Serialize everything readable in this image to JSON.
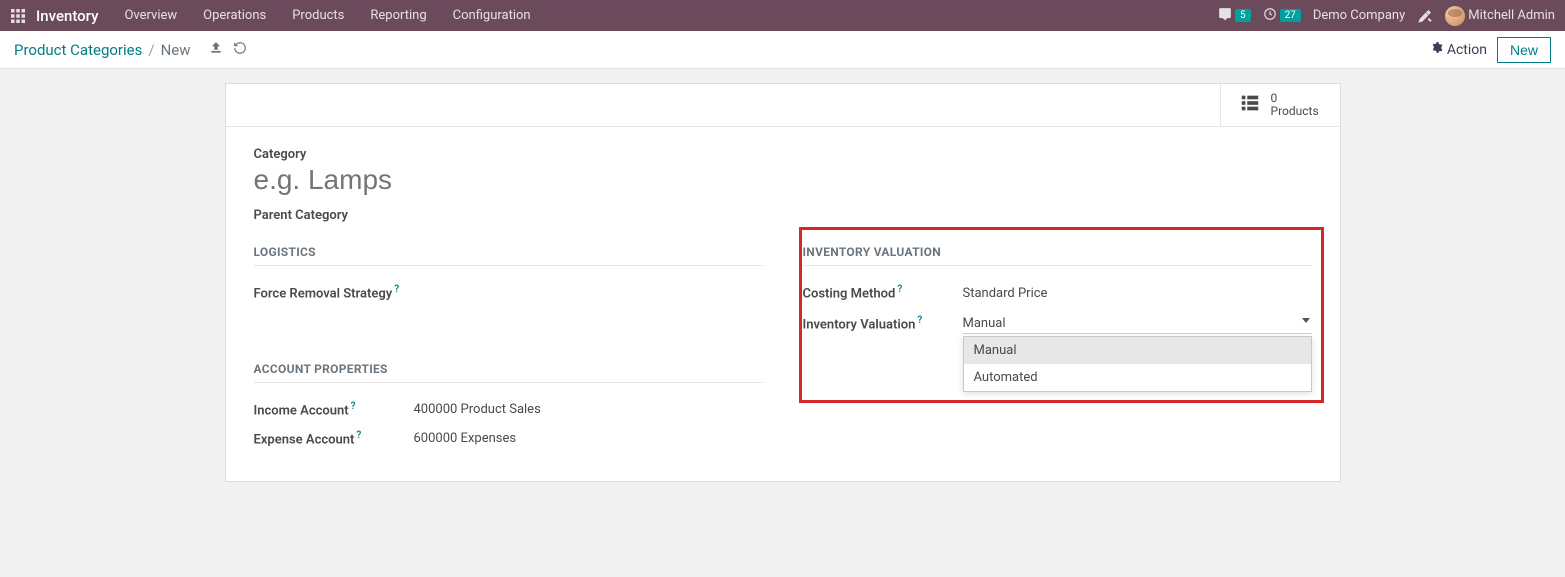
{
  "topnav": {
    "brand": "Inventory",
    "menu": [
      "Overview",
      "Operations",
      "Products",
      "Reporting",
      "Configuration"
    ],
    "messages_badge": "5",
    "activities_badge": "27",
    "company": "Demo Company",
    "user": "Mitchell Admin"
  },
  "breadcrumb": {
    "link": "Product Categories",
    "current": "New"
  },
  "control_panel": {
    "action_label": "Action",
    "new_label": "New"
  },
  "stat": {
    "count": "0",
    "label": "Products"
  },
  "form": {
    "category_label": "Category",
    "category_placeholder": "e.g. Lamps",
    "parent_category_label": "Parent Category",
    "logistics": {
      "title": "Logistics",
      "fields": {
        "force_removal_label": "Force Removal Strategy",
        "force_removal_value": ""
      }
    },
    "inventory_valuation": {
      "title": "Inventory Valuation",
      "costing_method_label": "Costing Method",
      "costing_method_value": "Standard Price",
      "valuation_label": "Inventory Valuation",
      "valuation_value": "Manual",
      "valuation_options": [
        "Manual",
        "Automated"
      ]
    },
    "account_properties": {
      "title": "Account Properties",
      "income_account_label": "Income Account",
      "income_account_value": "400000 Product Sales",
      "expense_account_label": "Expense Account",
      "expense_account_value": "600000 Expenses"
    }
  }
}
